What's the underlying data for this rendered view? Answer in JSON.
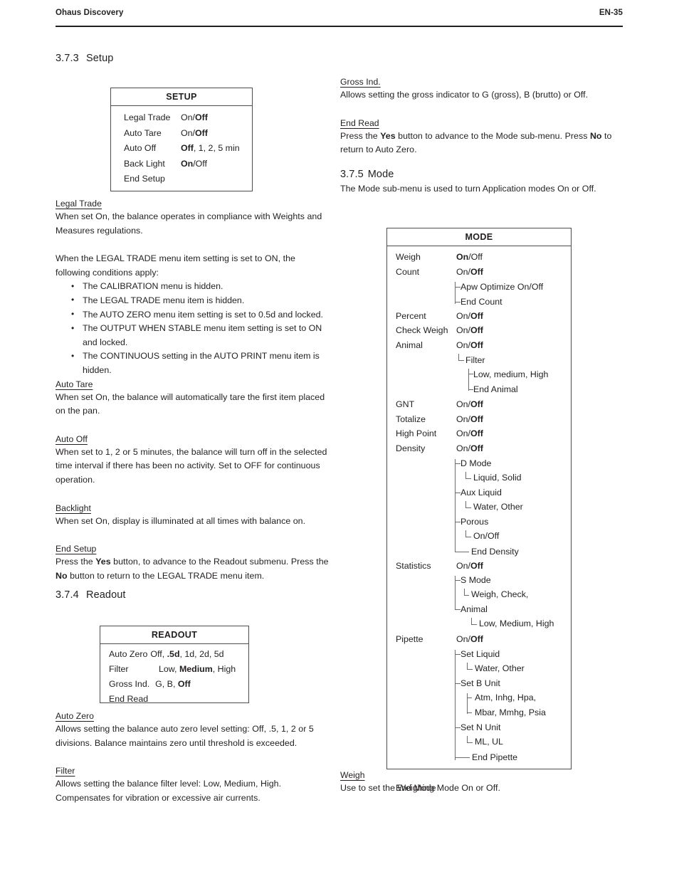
{
  "header": {
    "doc_title": "Ohaus Discovery",
    "page_number": "EN-35"
  },
  "left_column": {
    "section_setup": {
      "number": "3.7.3",
      "title": "Setup"
    },
    "setup_table": {
      "title": "SETUP",
      "rows": [
        {
          "label": "Legal Trade",
          "value_plain1": "On/",
          "value_bold": "Off",
          "value_plain2": ""
        },
        {
          "label": "Auto Tare",
          "value_plain1": "On/",
          "value_bold": "Off",
          "value_plain2": ""
        },
        {
          "label": "Auto Off",
          "value_plain1": "",
          "value_bold": "Off",
          "value_plain2": ", 1, 2, 5 min"
        },
        {
          "label": "Back Light",
          "value_plain1": "",
          "value_bold": "On",
          "value_plain2": "/Off"
        },
        {
          "label": "End Setup",
          "value_plain1": "",
          "value_bold": "",
          "value_plain2": ""
        }
      ]
    },
    "legal_trade": {
      "heading": "Legal Trade",
      "para1": "When set On, the balance operates in compliance with Weights and Measures regulations.",
      "para2": "When the LEGAL TRADE menu item setting is set to ON, the following conditions apply:",
      "bullets": [
        "The CALIBRATION menu is hidden.",
        "The LEGAL TRADE menu item is hidden.",
        "The AUTO ZERO menu item setting is set to 0.5d and locked.",
        "The OUTPUT WHEN STABLE menu item setting is set to ON and locked.",
        "The CONTINUOUS setting in the AUTO PRINT menu item is hidden."
      ]
    },
    "auto_tare": {
      "heading": "Auto Tare ",
      "para": "When set On, the balance will automatically tare the first item placed on the pan."
    },
    "auto_off": {
      "heading": "Auto Off ",
      "para": "When set to 1, 2 or 5 minutes, the balance will turn off in the selected time interval if there has been no activity.  Set to OFF for continuous operation."
    },
    "backlight": {
      "heading": "Backlight",
      "para": "When set On, display is illuminated at all times with balance on."
    },
    "end_setup": {
      "heading": "End Setup ",
      "text_a": "Press the ",
      "bold_yes": "Yes",
      "text_b": " button, to advance to the Readout submenu.  Press the ",
      "bold_no": "No",
      "text_c": " button to return to the LEGAL TRADE menu item."
    },
    "section_readout": {
      "number": "3.7.4",
      "title": "Readout"
    },
    "readout_table": {
      "title": "READOUT",
      "rows": [
        {
          "label": "Auto Zero",
          "plain1": "Off, ",
          "bold": ".5d",
          "plain2": ", 1d, 2d, 5d"
        },
        {
          "label": "Filter",
          "plain1": "Low, ",
          "bold": "Medium",
          "plain2": ", High"
        },
        {
          "label": "Gross Ind.",
          "plain1": "G, B, ",
          "bold": "Off",
          "plain2": ""
        },
        {
          "label": "End Read",
          "plain1": "",
          "bold": "",
          "plain2": ""
        }
      ]
    },
    "auto_zero": {
      "heading": "Auto Zero",
      "para": "Allows setting the balance auto zero level setting: Off, .5, 1, 2 or 5 divisions.  Balance maintains zero until threshold is exceeded."
    },
    "filter": {
      "heading": "Filter",
      "para": "Allows setting the balance filter level: Low, Medium, High.  Compensates for vibration or excessive air currents."
    }
  },
  "right_column": {
    "gross_ind": {
      "heading": "Gross Ind.",
      "para": "Allows setting the gross indicator to G (gross), B (brutto) or Off."
    },
    "end_read": {
      "heading": "End Read ",
      "text_a": "Press the ",
      "bold_yes": "Yes",
      "text_b": " button to advance to the Mode sub-menu.  Press ",
      "bold_no": "No",
      "text_c": " to return to Auto Zero."
    },
    "section_mode": {
      "number": "3.7.5",
      "title": "Mode",
      "intro": "The Mode sub-menu is used to turn Application modes On or Off."
    },
    "mode_table": {
      "title": "MODE",
      "entries": [
        {
          "label": "Weigh",
          "plain1": "",
          "bold": "On",
          "plain2": "/Off"
        },
        {
          "label": "Count",
          "plain1": "On/",
          "bold": "Off",
          "plain2": ""
        },
        {
          "label": "Percent",
          "plain1": "On/",
          "bold": "Off",
          "plain2": ""
        },
        {
          "label": "Check Weigh",
          "plain1": "On/",
          "bold": "Off",
          "plain2": ""
        },
        {
          "label": "Animal",
          "plain1": "On/",
          "bold": "Off",
          "plain2": ""
        },
        {
          "label": "GNT",
          "plain1": "On/",
          "bold": "Off",
          "plain2": ""
        },
        {
          "label": "Totalize",
          "plain1": "On/",
          "bold": "Off",
          "plain2": ""
        },
        {
          "label": "High Point",
          "plain1": "On/",
          "bold": "Off",
          "plain2": ""
        },
        {
          "label": "Density",
          "plain1": "On/",
          "bold": "Off",
          "plain2": ""
        },
        {
          "label": "Statistics",
          "plain1": "On/",
          "bold": "Off",
          "plain2": ""
        },
        {
          "label": "Pipette",
          "plain1": "On/",
          "bold": "Off",
          "plain2": ""
        }
      ],
      "count_sub": [
        "Apw Optimize On/Off",
        "End Count"
      ],
      "animal_sub": {
        "filter": "Filter",
        "filter_values": "Low, medium, High",
        "end": "End Animal"
      },
      "density_sub": {
        "d_mode": "D Mode",
        "d_mode_values": "Liquid, Solid",
        "aux_liquid": "Aux Liquid",
        "aux_liquid_values": "Water, Other",
        "porous": "Porous",
        "porous_values": "On/Off",
        "end": "End Density"
      },
      "statistics_sub": {
        "s_mode": "S Mode",
        "s_mode_values": "Weigh, Check,",
        "animal": "Animal",
        "animal_values": "Low, Medium, High"
      },
      "pipette_sub": {
        "set_liquid": "Set Liquid",
        "set_liquid_values": "Water, Other",
        "set_b_unit": "Set B Unit",
        "set_b_unit_values_1": "Atm, Inhg, Hpa,",
        "set_b_unit_values_2": "Mbar, Mmhg, Psia",
        "set_n_unit": "Set N Unit",
        "set_n_unit_values": "ML, UL",
        "end": "End Pipette"
      },
      "end_mode": "End Mode"
    },
    "weigh": {
      "heading": "Weigh ",
      "para": "Use to set the Weighing Mode On or Off."
    }
  }
}
